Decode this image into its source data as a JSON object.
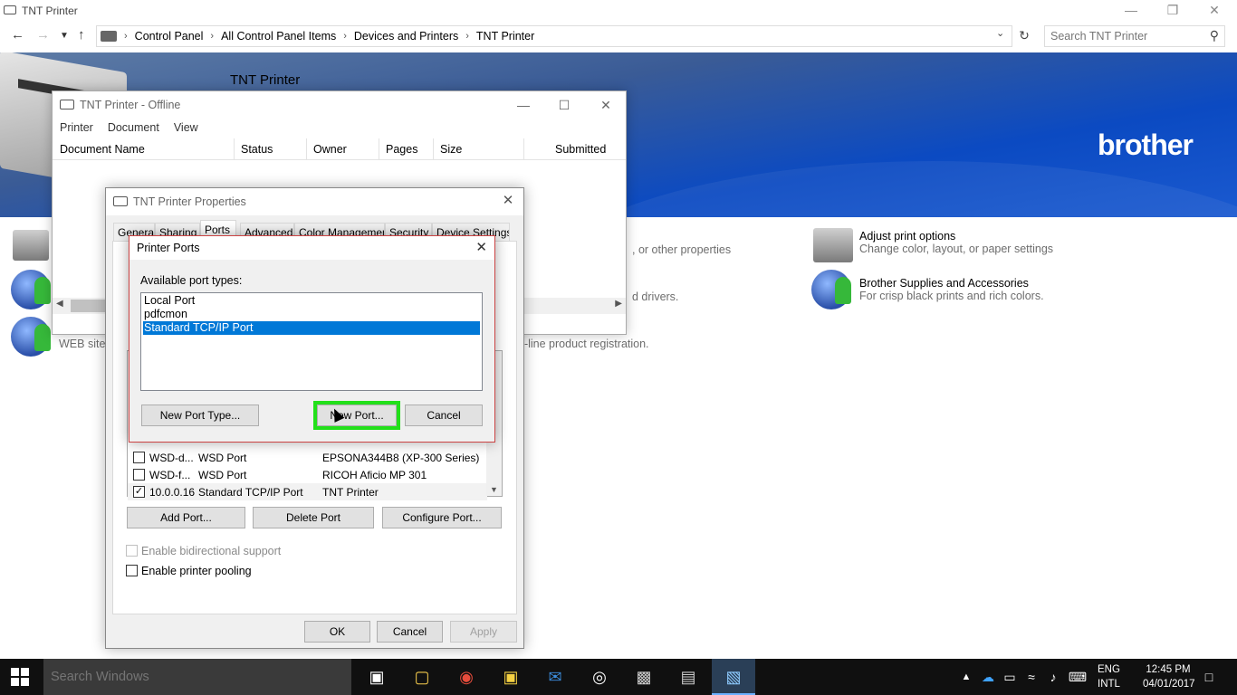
{
  "explorer": {
    "title": "TNT Printer",
    "breadcrumb": [
      "Control Panel",
      "All Control Panel Items",
      "Devices and Printers",
      "TNT Printer"
    ],
    "search_placeholder": "Search TNT Printer",
    "banner_title": "TNT Printer",
    "brand": "brother"
  },
  "tasks": {
    "left_text": "WEB site f",
    "mid1": ", or other properties",
    "mid2": "d drivers.",
    "mid3": "n-line product registration.",
    "adjust_title": "Adjust print options",
    "adjust_desc": "Change color, layout, or paper settings",
    "supplies_title": "Brother Supplies and Accessories",
    "supplies_desc": "For crisp black prints and rich colors."
  },
  "queue": {
    "title": "TNT Printer - Offline",
    "menu": [
      "Printer",
      "Document",
      "View"
    ],
    "columns": [
      "Document Name",
      "Status",
      "Owner",
      "Pages",
      "Size",
      "Submitted"
    ]
  },
  "props": {
    "title": "TNT Printer Properties",
    "tabs": [
      "General",
      "Sharing",
      "Ports",
      "Advanced",
      "Color Management",
      "Security",
      "Device Settings"
    ],
    "ports": [
      {
        "name": "WSD-d...",
        "desc": "WSD Port",
        "printer": "EPSONA344B8 (XP-300 Series)",
        "checked": false
      },
      {
        "name": "WSD-f...",
        "desc": "WSD Port",
        "printer": "RICOH Aficio MP 301",
        "checked": false
      },
      {
        "name": "10.0.0.16",
        "desc": "Standard TCP/IP Port",
        "printer": "TNT Printer",
        "checked": true
      }
    ],
    "add_port": "Add Port...",
    "delete_port": "Delete Port",
    "configure_port": "Configure Port...",
    "bidi": "Enable bidirectional support",
    "pooling": "Enable printer pooling",
    "ok": "OK",
    "cancel": "Cancel",
    "apply": "Apply"
  },
  "ports_dialog": {
    "title": "Printer Ports",
    "label": "Available port types:",
    "types": [
      "Local Port",
      "pdfcmon",
      "Standard TCP/IP Port"
    ],
    "selected": "Standard TCP/IP Port",
    "new_port_type": "New Port Type...",
    "new_port": "New Port...",
    "cancel": "Cancel",
    "highlight_color": "#22e01a"
  },
  "taskbar": {
    "search_placeholder": "Search Windows",
    "lang1": "ENG",
    "lang2": "INTL",
    "time": "12:45 PM",
    "date": "04/01/2017"
  }
}
